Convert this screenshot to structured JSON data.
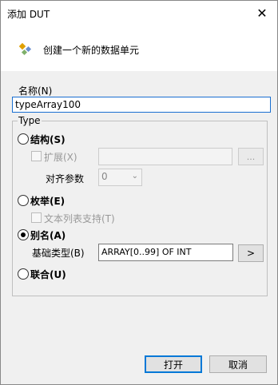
{
  "window": {
    "title": "添加 DUT",
    "close": "✕"
  },
  "header": {
    "text": "创建一个新的数据单元",
    "icon": "dut-icon"
  },
  "name": {
    "label": "名称(N)",
    "value": "typeArray100"
  },
  "type_group": {
    "label": "Type"
  },
  "struct": {
    "label": "结构(S)",
    "extends_label": "扩展(X)",
    "browse_label": "...",
    "align_label": "对齐参数",
    "align_value": "0"
  },
  "enum": {
    "label": "枚举(E)",
    "textlist_label": "文本列表支持(T)"
  },
  "alias": {
    "label": "别名(A)",
    "base_type_label": "基础类型(B)",
    "base_type_value": "ARRAY[0..99] OF INT",
    "picker_label": ">"
  },
  "union": {
    "label": "联合(U)"
  },
  "buttons": {
    "open": "打开",
    "cancel": "取消"
  }
}
